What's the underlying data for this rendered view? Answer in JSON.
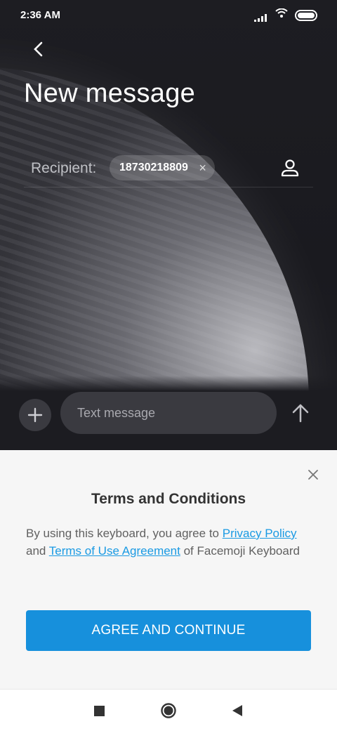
{
  "status_bar": {
    "time": "2:36 AM",
    "icons": [
      "signal-icon",
      "wifi-icon",
      "battery-icon"
    ]
  },
  "header": {
    "back_icon": "chevron-left-icon",
    "title": "New message"
  },
  "recipient": {
    "label": "Recipient:",
    "chip_number": "18730218809",
    "chip_remove_icon": "×",
    "contact_icon": "person-icon"
  },
  "compose": {
    "attach_icon": "plus-icon",
    "placeholder": "Text message",
    "send_icon": "arrow-up-icon"
  },
  "terms_sheet": {
    "close_icon": "close-icon",
    "title": "Terms and Conditions",
    "text_prefix": "By using this keyboard, you agree to ",
    "privacy_link": "Privacy Policy",
    "text_and": " and ",
    "terms_link": "Terms of Use Agreement",
    "text_suffix": " of Facemoji Keyboard",
    "button_label": "AGREE AND CONTINUE",
    "accent_color": "#1790dc",
    "link_color": "#1a9ae3"
  },
  "nav_bar": {
    "recents_icon": "square-icon",
    "home_icon": "circle-icon",
    "back_icon": "triangle-back-icon"
  }
}
